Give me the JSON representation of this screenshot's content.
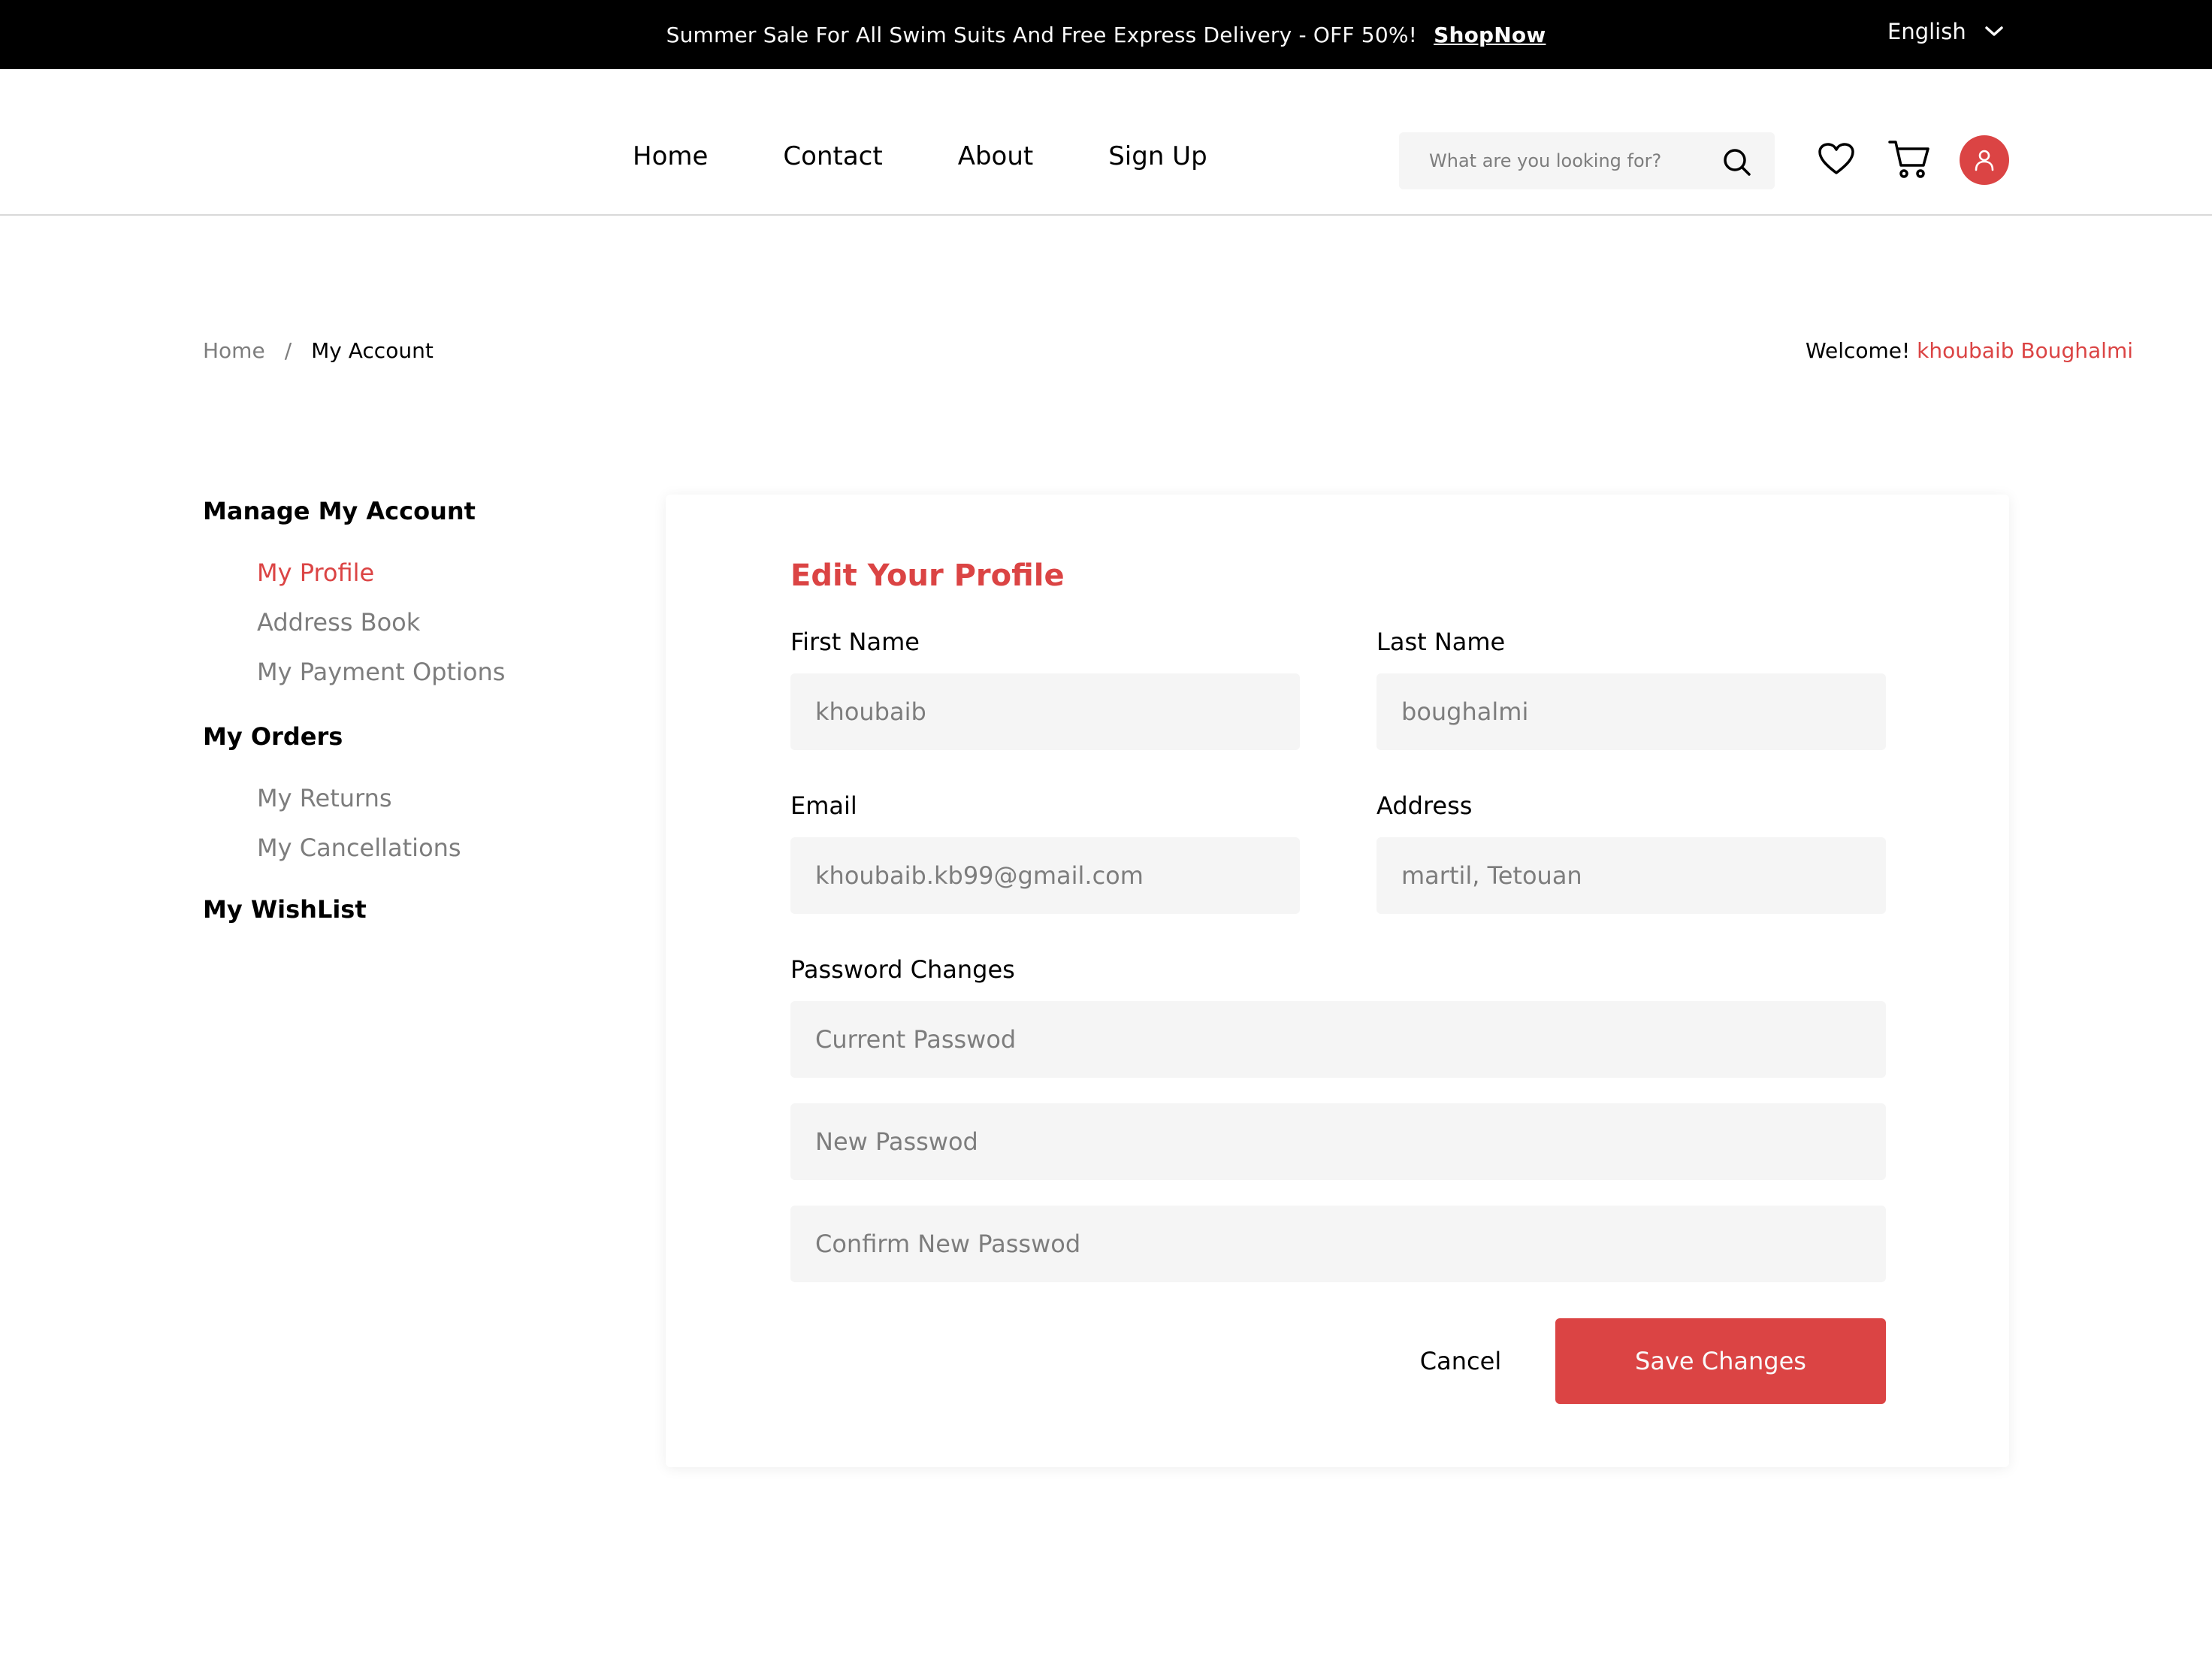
{
  "topbar": {
    "promo_text": "Summer Sale For All Swim Suits And Free Express Delivery - OFF 50%!",
    "promo_link": "ShopNow",
    "language": "English"
  },
  "header": {
    "nav": [
      "Home",
      "Contact",
      "About",
      "Sign Up"
    ],
    "search_placeholder": "What are you looking for?",
    "icons": [
      "search-icon",
      "heart-icon",
      "cart-icon",
      "user-icon"
    ]
  },
  "breadcrumb": {
    "home": "Home",
    "separator": "/",
    "current": "My Account"
  },
  "welcome": {
    "prefix": "Welcome!",
    "name": "khoubaib Boughalmi"
  },
  "sidebar": {
    "sections": [
      {
        "title": "Manage My Account",
        "items": [
          "My Profile",
          "Address Book",
          "My Payment Options"
        ]
      },
      {
        "title": "My Orders",
        "items": [
          "My Returns",
          "My Cancellations"
        ]
      },
      {
        "title": "My WishList",
        "items": []
      }
    ]
  },
  "profile": {
    "title": "Edit Your Profile",
    "first_name_label": "First Name",
    "first_name": "khoubaib",
    "last_name_label": "Last Name",
    "last_name": "boughalmi",
    "email_label": "Email",
    "email": "khoubaib.kb99@gmail.com",
    "address_label": "Address",
    "address": "martil, Tetouan",
    "password_label": "Password Changes",
    "current_password_placeholder": "Current Passwod",
    "new_password_placeholder": "New Passwod",
    "confirm_password_placeholder": "Confirm New Passwod",
    "cancel_label": "Cancel",
    "save_label": "Save Changes"
  },
  "colors": {
    "accent": "#DB4444",
    "topbar_bg": "#000000",
    "field_bg": "#F5F5F5",
    "muted_text": "#7D7D7D"
  }
}
